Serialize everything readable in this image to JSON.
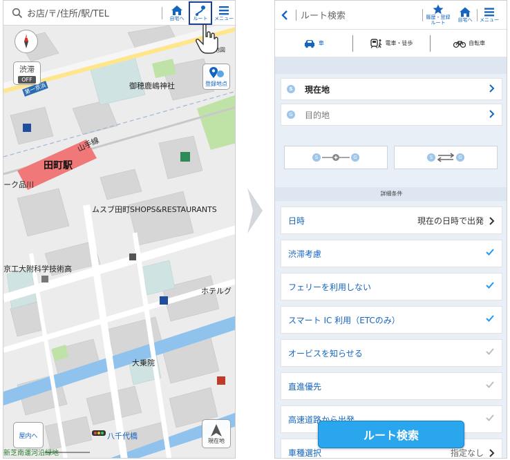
{
  "map_screen": {
    "search": {
      "placeholder": "お店/〒/住所/駅/TEL"
    },
    "top_buttons": {
      "home": "自宅へ",
      "route": "ルート",
      "menu": "メニュー"
    },
    "traffic": {
      "label": "渋滞",
      "state": "OFF"
    },
    "register": {
      "label": "登録地点"
    },
    "indoor": {
      "label": "屋内へ"
    },
    "current": {
      "label": "現在地"
    },
    "map_labels": {
      "station": "田町駅",
      "yamanote": "山手線",
      "keihin": "第一京浜",
      "shrine": "御穂鹿嶋神社",
      "mall": "ムスブ田町SHOPS&RESTAURANTS",
      "hs": "京工大附科学技術高",
      "hotel": "ホテルグ",
      "shinagawa": "ーク品川",
      "daijoin": "大乗院",
      "yachiyo": "八千代橋",
      "canal": "新芝南運河沿緑地",
      "map_top": "地図"
    }
  },
  "route_screen": {
    "title": "ルート検索",
    "header_buttons": {
      "favorite": "履歴・登録\nルート",
      "home": "自宅へ",
      "menu": "メニュー"
    },
    "modes": [
      {
        "label": "車",
        "icon": "car-icon"
      },
      {
        "label": "電車・徒歩",
        "icon": "train-icon"
      },
      {
        "label": "自転車",
        "icon": "bicycle-icon"
      }
    ],
    "start": {
      "badge": "S",
      "label": "現在地"
    },
    "goal": {
      "badge": "G",
      "label": "目的地"
    },
    "stopover": {
      "s": "S",
      "g": "G"
    },
    "details_header": "詳細条件",
    "options": [
      {
        "label": "日時",
        "value": "現在の日時で出発",
        "type": "chevron"
      },
      {
        "label": "渋滞考慮",
        "type": "check",
        "checked": true
      },
      {
        "label": "フェリーを利用しない",
        "type": "check",
        "checked": true
      },
      {
        "label": "スマート IC 利用（ETCのみ）",
        "type": "check",
        "checked": true
      },
      {
        "label": "オービスを知らせる",
        "type": "check",
        "checked": false
      },
      {
        "label": "直進優先",
        "type": "check",
        "checked": false
      },
      {
        "label": "高速道路から出発",
        "type": "check",
        "checked": false
      },
      {
        "label": "車種選択",
        "value": "指定なし",
        "type": "chevron"
      }
    ],
    "search_button": "ルート検索"
  },
  "colors": {
    "accent": "#1565c0",
    "button": "#2aa6ef",
    "checked": "#2196f3",
    "unchecked": "#bdbdbd",
    "station": "#f07878",
    "water": "#8fc3ee",
    "park": "#bfe2a7"
  }
}
